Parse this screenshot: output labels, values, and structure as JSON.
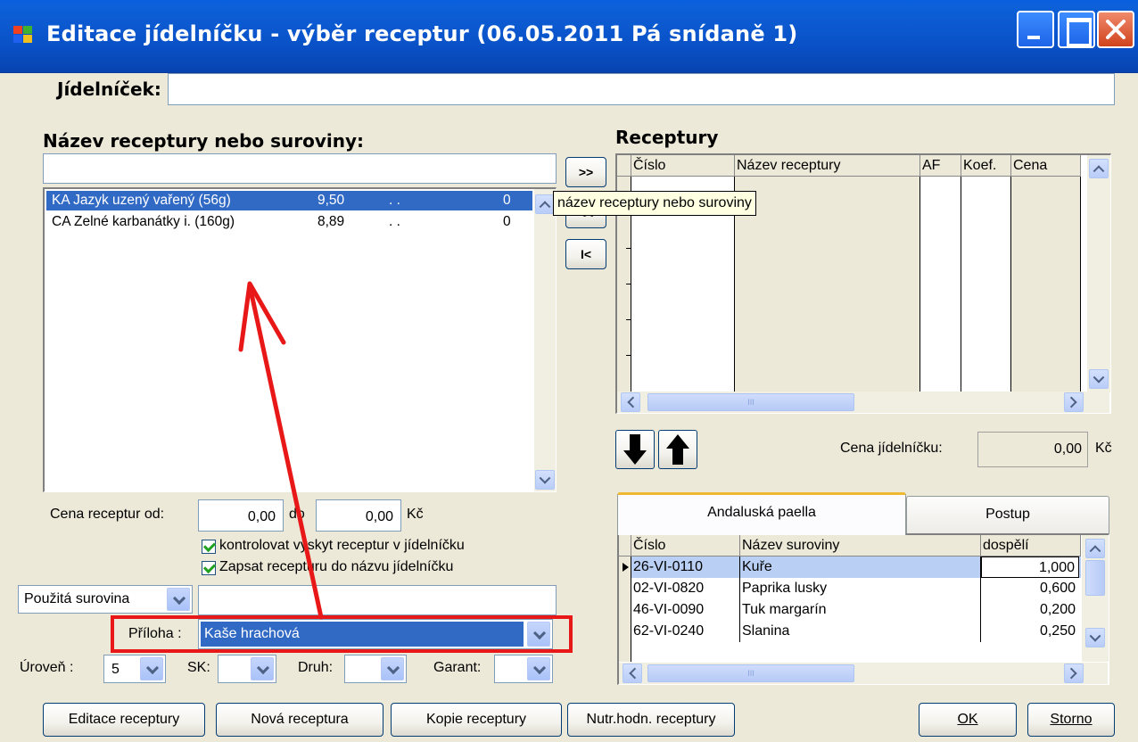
{
  "window": {
    "title": "Editace jídelníčku - výběr receptur (06.05.2011 Pá snídaně 1)"
  },
  "jidelnicek": {
    "label": "Jídelníček:",
    "value": ""
  },
  "search": {
    "label": "Název receptury nebo suroviny:",
    "value": "",
    "results": [
      {
        "name": "KA Jazyk uzený vařený  (56g)",
        "price": "9,50",
        "dots": ". .",
        "count": "0",
        "selected": true
      },
      {
        "name": "CA Zelné karbanátky i.  (160g)",
        "price": "8,89",
        "dots": ". .",
        "count": "0",
        "selected": false
      }
    ]
  },
  "transfer": {
    "add_all": ">>",
    "add": "<<",
    "first": "I<"
  },
  "tooltip": "název receptury nebo suroviny",
  "receptury": {
    "label": "Receptury",
    "columns": [
      "Číslo",
      "Název receptury",
      "AF",
      "Koef.",
      "Cena"
    ],
    "scroll_mark": "III"
  },
  "cena_jidelnicku": {
    "label": "Cena jídelníčku:",
    "value": "0,00",
    "unit": "Kč"
  },
  "price_filter": {
    "label_from": "Cena receptur od:",
    "from_value": "0,00",
    "label_to": "do",
    "to_value": "0,00",
    "unit": "Kč"
  },
  "options": {
    "check1": "kontrolovat výskyt receptur v jídelníčku",
    "check2": "Zapsat recepturu do názvu jídelníčku"
  },
  "ingredient": {
    "select": "Použitá surovina",
    "value": ""
  },
  "priloha": {
    "label": "Příloha :",
    "value": "Kaše hrachová"
  },
  "filters": {
    "uroven_label": "Úroveň :",
    "uroven_value": "5",
    "sk_label": "SK:",
    "druh_label": "Druh:",
    "garant_label": "Garant:"
  },
  "tabs": [
    {
      "label": "Andaluská paella",
      "active": true
    },
    {
      "label": "Postup",
      "active": false
    }
  ],
  "ingredients_table": {
    "columns": [
      "Číslo",
      "Název suroviny",
      "dospělí"
    ],
    "rows": [
      {
        "code": "26-VI-0110",
        "name": "Kuře",
        "amount": "1,000"
      },
      {
        "code": "02-VI-0820",
        "name": "Paprika lusky",
        "amount": "0,600"
      },
      {
        "code": "46-VI-0090",
        "name": "Tuk margarín",
        "amount": "0,200"
      },
      {
        "code": "62-VI-0240",
        "name": "Slanina",
        "amount": "0,250"
      }
    ],
    "scroll_mark": "III"
  },
  "buttons": {
    "edit": "Editace receptury",
    "new": "Nová receptura",
    "copy": "Kopie receptury",
    "nutr": "Nutr.hodn. receptury",
    "ok": "OK",
    "cancel": "Storno"
  },
  "colors": {
    "titlebar": "#0a52c8",
    "selection": "#316ac5",
    "highlight_box": "#e81818",
    "arrow": "#e81818"
  }
}
